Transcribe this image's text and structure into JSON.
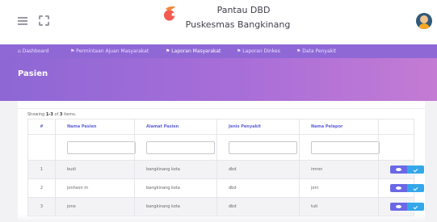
{
  "header": {
    "app_name": "Pantau DBD",
    "subtitle": "Puskesmas Bangkinang"
  },
  "nav": {
    "items": [
      {
        "label": "Dashboard",
        "icon": "home-icon"
      },
      {
        "label": "Permintaan Ajuan Masyarakat",
        "icon": "flag-icon"
      },
      {
        "label": "Laporan Masyarakat",
        "icon": "flag-icon",
        "active": true
      },
      {
        "label": "Laporan Dinkes",
        "icon": "flag-icon"
      },
      {
        "label": "Data Penyakit",
        "icon": "flag-icon"
      }
    ]
  },
  "page": {
    "title": "Pasien"
  },
  "table": {
    "summary_prefix": "Showing ",
    "summary_range": "1-3",
    "summary_of": " of ",
    "summary_total": "3",
    "summary_suffix": " items.",
    "columns": [
      "#",
      "Nama Pasien",
      "Alamat Pasien",
      "Jenis Penyakit",
      "Nama Pelapor"
    ],
    "rows": [
      {
        "no": "1",
        "nama": "budi",
        "alamat": "bangkinang kota",
        "penyakit": "dbd",
        "pelapor": "imron"
      },
      {
        "no": "2",
        "nama": "jonhson m",
        "alamat": "bangkinang kota",
        "penyakit": "dbd",
        "pelapor": "joni"
      },
      {
        "no": "3",
        "nama": "jono",
        "alamat": "bangkinang kota",
        "penyakit": "dbd",
        "pelapor": "tuti"
      }
    ]
  },
  "colors": {
    "nav": "#8f68d6",
    "hero_start": "#8d67d5",
    "hero_end": "#c47bd4",
    "header_text": "#5f63d8",
    "view_button": "#6b68e6",
    "edit_button": "#34a7ea"
  }
}
